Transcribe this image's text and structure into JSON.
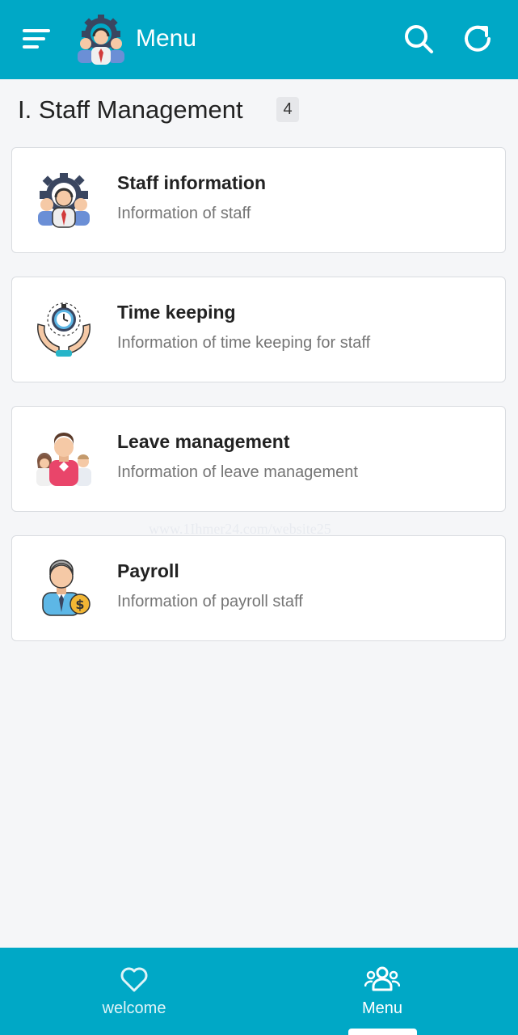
{
  "header": {
    "title": "Menu",
    "menu_icon": "hamburger-menu-icon",
    "logo_icon": "staff-gear-logo-icon",
    "search_icon": "search-icon",
    "refresh_icon": "refresh-icon",
    "background_color": "#00a8c6"
  },
  "section": {
    "title": "I. Staff Management",
    "count": "4"
  },
  "items": [
    {
      "title": "Staff information",
      "description": "Information of staff",
      "icon": "staff-gear-icon"
    },
    {
      "title": "Time keeping",
      "description": "Information of time keeping for staff",
      "icon": "stopwatch-hands-icon"
    },
    {
      "title": "Leave management",
      "description": "Information of leave management",
      "icon": "team-people-icon"
    },
    {
      "title": "Payroll",
      "description": "Information of payroll staff",
      "icon": "payroll-employee-icon"
    }
  ],
  "watermark": "www.1Ihmer24.com/website25",
  "bottom_nav": {
    "tabs": [
      {
        "label": "welcome",
        "icon": "heart-icon",
        "active": false
      },
      {
        "label": "Menu",
        "icon": "users-group-icon",
        "active": true
      }
    ],
    "active_color": "#ffffff",
    "inactive_color": "#e0f4f8"
  }
}
